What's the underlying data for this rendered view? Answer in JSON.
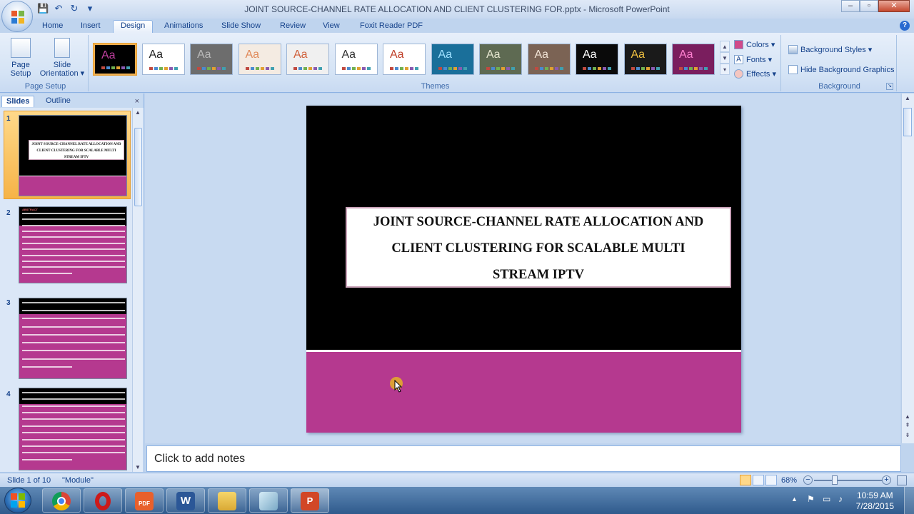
{
  "window": {
    "title": "JOINT SOURCE-CHANNEL RATE ALLOCATION AND CLIENT CLUSTERING FOR.pptx - Microsoft PowerPoint",
    "minimize": "–",
    "maximize": "▫",
    "close": "✕"
  },
  "quick_access": {
    "save": "💾",
    "undo": "↶",
    "redo": "↻",
    "customize": "▾"
  },
  "tabs": [
    "Home",
    "Insert",
    "Design",
    "Animations",
    "Slide Show",
    "Review",
    "View",
    "Foxit Reader PDF"
  ],
  "active_tab": "Design",
  "help": "?",
  "ribbon": {
    "page_setup": {
      "page_setup_label_1": "Page",
      "page_setup_label_2": "Setup",
      "orientation_label_1": "Slide",
      "orientation_label_2": "Orientation ▾",
      "group_label": "Page Setup"
    },
    "themes": {
      "group_label": "Themes",
      "items": [
        {
          "aa": "Aa",
          "bg": "#000000",
          "fg": "#c03fa0",
          "bar": "#b5398f",
          "selected": true
        },
        {
          "aa": "Aa",
          "bg": "#ffffff",
          "fg": "#222222",
          "bar": "#ffffff",
          "selected": false
        },
        {
          "aa": "Aa",
          "bg": "#6d6d6d",
          "fg": "#b9b9b9",
          "bar": "#5a5a5a",
          "selected": false
        },
        {
          "aa": "Aa",
          "bg": "#f4ebe2",
          "fg": "#e08a5a",
          "bar": "#e9d6c7",
          "selected": false
        },
        {
          "aa": "Aa",
          "bg": "#f0f0f0",
          "fg": "#d0603a",
          "bar": "#c0c0c0",
          "selected": false
        },
        {
          "aa": "Aa",
          "bg": "#ffffff",
          "fg": "#333333",
          "bar": "#2a5a8a",
          "selected": false
        },
        {
          "aa": "Aa",
          "bg": "#ffffff",
          "fg": "#c0402a",
          "bar": "#c0402a",
          "selected": false
        },
        {
          "aa": "Aa",
          "bg": "#1a6f9a",
          "fg": "#9fe0ff",
          "bar": "#1a6f9a",
          "selected": false
        },
        {
          "aa": "Aa",
          "bg": "#5e6a52",
          "fg": "#e6e6d0",
          "bar": "#4b5542",
          "selected": false
        },
        {
          "aa": "Aa",
          "bg": "#7b6354",
          "fg": "#f0e2d4",
          "bar": "#6a5446",
          "selected": false
        },
        {
          "aa": "Aa",
          "bg": "#0a0a0a",
          "fg": "#ffffff",
          "bar": "#333333",
          "selected": false
        },
        {
          "aa": "Aa",
          "bg": "#1a1a1a",
          "fg": "#f0c040",
          "bar": "#303030",
          "selected": false
        },
        {
          "aa": "Aa",
          "bg": "#7a1e5e",
          "fg": "#ff80d0",
          "bar": "#a8307a",
          "selected": false
        }
      ]
    },
    "theme_options": {
      "colors": "Colors ▾",
      "fonts": "Fonts ▾",
      "effects": "Effects ▾"
    },
    "background": {
      "styles": "Background Styles ▾",
      "hide_graphics": "Hide Background Graphics",
      "hide_checked": false,
      "group_label": "Background"
    }
  },
  "left_panel": {
    "tab_slides": "Slides",
    "tab_outline": "Outline",
    "close": "×",
    "slides": [
      {
        "num": "1",
        "title": "JOINT SOURCE-CHANNEL RATE ALLOCATION AND CLIENT CLUSTERING FOR SCALABLE MULTI STREAM IPTV"
      },
      {
        "num": "2",
        "title": "ABSTRACT"
      },
      {
        "num": "3",
        "title": ""
      },
      {
        "num": "4",
        "title": ""
      }
    ]
  },
  "slide": {
    "title_line1": "JOINT SOURCE-CHANNEL RATE ALLOCATION AND",
    "title_line2": "CLIENT CLUSTERING FOR SCALABLE MULTI",
    "title_line3": "STREAM IPTV",
    "colors": {
      "top": "#000000",
      "bottom": "#b5398f",
      "border": "#c9a2b8"
    }
  },
  "notes": {
    "placeholder": "Click to add notes"
  },
  "status": {
    "slide_info": "Slide 1 of 10",
    "theme_name": "\"Module\"",
    "zoom": "68%",
    "zoom_fraction": 0.68
  },
  "taskbar": {
    "time": "10:59 AM",
    "date": "7/28/2015",
    "apps": [
      "chrome-icon",
      "opera-icon",
      "pdf-icon",
      "word-icon",
      "explorer-icon",
      "glass-icon",
      "powerpoint-icon"
    ]
  }
}
